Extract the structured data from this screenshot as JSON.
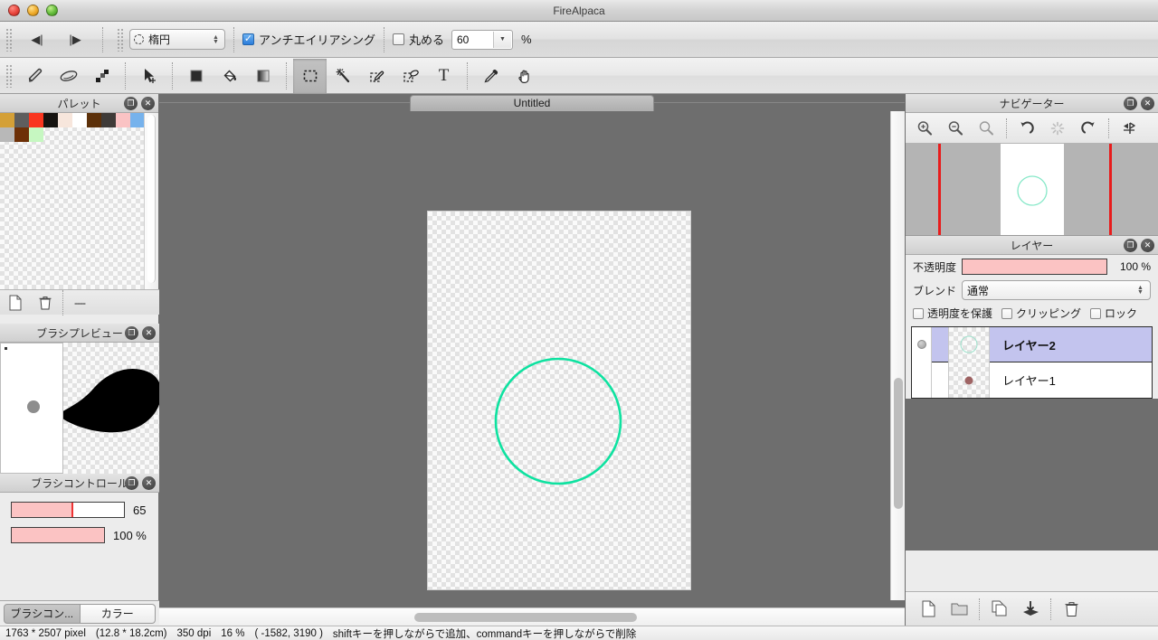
{
  "window": {
    "title": "FireAlpaca",
    "controls": [
      "close-button",
      "minimize-button",
      "zoom-button"
    ]
  },
  "option_bar": {
    "nav_prev": "◀|",
    "nav_next": "|▶",
    "shape_combo": {
      "value": "楕円",
      "icon": "ellipse-icon"
    },
    "antialias": {
      "label": "アンチエイリアシング",
      "checked": true
    },
    "round": {
      "label": "丸める",
      "checked": false
    },
    "round_value": "60",
    "percent_label": "%"
  },
  "toolbar": {
    "tools": [
      {
        "name": "pencil-tool",
        "glyph": "pencil",
        "active": false
      },
      {
        "name": "eraser-tool",
        "glyph": "eraser",
        "active": false
      },
      {
        "name": "blur-tool",
        "glyph": "blur",
        "active": false
      },
      {
        "name": "move-tool",
        "glyph": "move",
        "active": false
      },
      {
        "name": "fill-tool",
        "glyph": "fill-square",
        "active": false
      },
      {
        "name": "bucket-tool",
        "glyph": "bucket",
        "active": false
      },
      {
        "name": "gradient-tool",
        "glyph": "gradient",
        "active": false
      },
      {
        "name": "select-tool",
        "glyph": "marquee",
        "active": true
      },
      {
        "name": "magic-wand-tool",
        "glyph": "wand",
        "active": false
      },
      {
        "name": "select-pen-tool",
        "glyph": "select-pen",
        "active": false
      },
      {
        "name": "select-eraser-tool",
        "glyph": "select-eraser",
        "active": false
      },
      {
        "name": "text-tool",
        "glyph": "T",
        "active": false
      },
      {
        "name": "eyedropper-tool",
        "glyph": "dropper",
        "active": false
      },
      {
        "name": "hand-tool",
        "glyph": "hand",
        "active": false
      }
    ]
  },
  "palette_panel": {
    "title": "パレット",
    "swatches": [
      "#d4a037",
      "#5e5e5e",
      "#f9361f",
      "#161310",
      "#f7e6dc",
      "#ffffff",
      "#5c3009",
      "#3f3b38",
      "#fac3c4",
      "#76b2ec",
      "#b8b8b8",
      "#6d3007",
      "#c6f7c1"
    ],
    "footer": {
      "new_icon": "new-file-icon",
      "delete_icon": "trash-icon",
      "more_label": "----"
    }
  },
  "brush_preview_panel": {
    "title": "ブラシプレビュー"
  },
  "brush_control_panel": {
    "title": "ブラシコントロール",
    "size": {
      "value": "65",
      "fill_percent": 53
    },
    "opacity": {
      "value": "100 %",
      "fill_percent": 100
    }
  },
  "left_tabs": [
    {
      "label": "ブラシコン...",
      "active": true
    },
    {
      "label": "カラー",
      "active": false
    }
  ],
  "canvas": {
    "document_tab": "Untitled",
    "circle_color": "#0ee2a0",
    "paper_color": "#ececec",
    "background_color": "#6e6e6e"
  },
  "navigator_panel": {
    "title": "ナビゲーター",
    "tools": [
      {
        "name": "zoom-in-icon"
      },
      {
        "name": "zoom-out-icon"
      },
      {
        "name": "zoom-reset-icon"
      },
      {
        "name": "rotate-left-icon"
      },
      {
        "name": "rotate-reset-icon"
      },
      {
        "name": "rotate-right-icon"
      },
      {
        "name": "flip-horizontal-icon"
      }
    ]
  },
  "layer_panel": {
    "title": "レイヤー",
    "opacity_label": "不透明度",
    "opacity_value": "100 %",
    "blend_label": "ブレンド",
    "blend_value": "通常",
    "checkboxes": [
      {
        "label": "透明度を保護",
        "checked": false
      },
      {
        "label": "クリッピング",
        "checked": false
      },
      {
        "label": "ロック",
        "checked": false
      }
    ],
    "layers": [
      {
        "name": "レイヤー2",
        "selected": true,
        "visible": true,
        "thumb": "circle"
      },
      {
        "name": "レイヤー1",
        "selected": false,
        "visible": false,
        "thumb": "dot"
      }
    ],
    "footer_icons": [
      {
        "name": "new-layer-icon"
      },
      {
        "name": "new-folder-icon"
      },
      {
        "name": "duplicate-layer-icon"
      },
      {
        "name": "merge-layer-icon"
      },
      {
        "name": "delete-layer-icon"
      }
    ]
  },
  "status_bar": {
    "dimensions": "1763 * 2507 pixel",
    "physical": "(12.8 * 18.2cm)",
    "dpi": "350 dpi",
    "zoom": "16 %",
    "coords": "( -1582, 3190 )",
    "hint": "shiftキーを押しながらで追加、commandキーを押しながらで削除"
  }
}
